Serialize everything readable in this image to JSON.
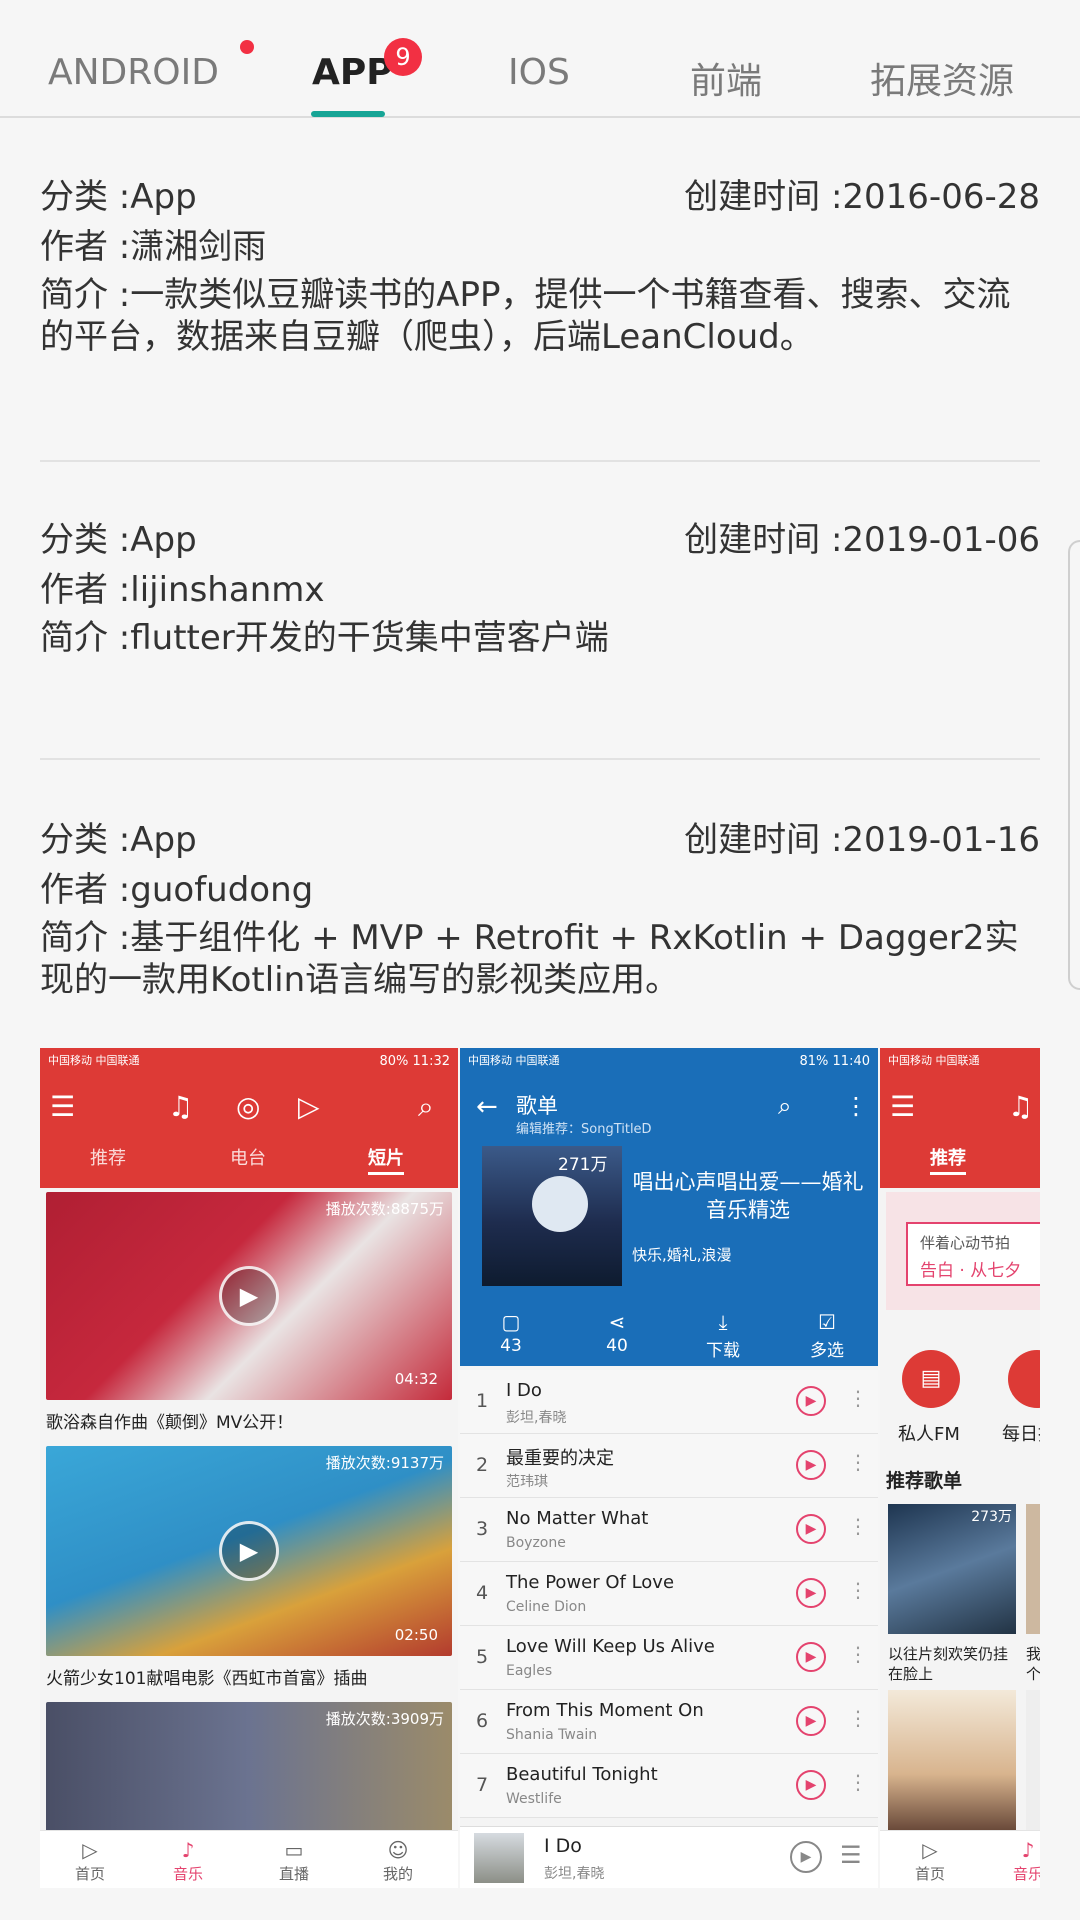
{
  "tabs": [
    {
      "label": "ANDROID"
    },
    {
      "label": "APP",
      "badge": "9"
    },
    {
      "label": "IOS"
    },
    {
      "label": "前端"
    },
    {
      "label": "拓展资源"
    }
  ],
  "entries": [
    {
      "category": "分类 :App",
      "created": "创建时间 :2016-06-28",
      "author": "作者 :潇湘剑雨",
      "desc": "简介 :一款类似豆瓣读书的APP，提供一个书籍查看、搜索、交流的平台，数据来自豆瓣（爬虫），后端LeanCloud。"
    },
    {
      "category": "分类 :App",
      "created": "创建时间 :2019-01-06",
      "author": "作者 :lijinshanmx",
      "desc": "简介 :flutter开发的干货集中营客户端"
    },
    {
      "category": "分类 :App",
      "created": "创建时间 :2019-01-16",
      "author": "作者 :guofudong",
      "desc": "简介 :基于组件化 + MVP + Retrofit + RxKotlin + Dagger2实现的一款用Kotlin语言编写的影视类应用。"
    }
  ],
  "shot1": {
    "status_left": "中国移动 中国联通",
    "status_right": "80% 11:32",
    "tabs": [
      "推荐",
      "电台",
      "短片"
    ],
    "videos": [
      {
        "plays": "播放次数:8875万",
        "duration": "04:32",
        "caption": "歌浴森自作曲《颠倒》MV公开！"
      },
      {
        "plays": "播放次数:9137万",
        "duration": "02:50",
        "caption": "火箭少女101献唱电影《西虹市首富》插曲"
      },
      {
        "plays": "播放次数:3909万",
        "duration": "",
        "caption": ""
      }
    ],
    "nav": [
      "首页",
      "音乐",
      "直播",
      "我的"
    ]
  },
  "shot2": {
    "status_left": "中国移动 中国联通",
    "status_right": "81% 11:40",
    "title": "歌单",
    "subtitle": "编辑推荐：SongTitleD",
    "cover_count": "271万",
    "playlist_title": "唱出心声唱出爱——婚礼音乐精选",
    "tags": "快乐,婚礼,浪漫",
    "actions": [
      {
        "icon": "comment-icon",
        "label": "43"
      },
      {
        "icon": "share-icon",
        "label": "40"
      },
      {
        "icon": "download-icon",
        "label": "下载"
      },
      {
        "icon": "checkbox-icon",
        "label": "多选"
      }
    ],
    "songs": [
      {
        "num": "1",
        "title": "I Do",
        "artist": "彭坦,春晓"
      },
      {
        "num": "2",
        "title": "最重要的决定",
        "artist": "范玮琪"
      },
      {
        "num": "3",
        "title": "No Matter What",
        "artist": "Boyzone"
      },
      {
        "num": "4",
        "title": "The Power Of Love",
        "artist": "Celine Dion"
      },
      {
        "num": "5",
        "title": "Love Will Keep Us Alive",
        "artist": "Eagles"
      },
      {
        "num": "6",
        "title": "From This Moment On",
        "artist": "Shania Twain"
      },
      {
        "num": "7",
        "title": "Beautiful Tonight",
        "artist": "Westlife"
      }
    ],
    "player": {
      "title": "I Do",
      "artist": "彭坦,春晓"
    }
  },
  "shot3": {
    "status_left": "中国移动 中国联通",
    "tab": "推荐",
    "banner_text": "伴着心动节拍",
    "banner_big": "告白 · 从七夕",
    "fm_label": "私人FM",
    "daily_label": "每日推",
    "section": "推荐歌单",
    "card_count": "273万",
    "card_caption": "以往片刻欢笑仍挂在脸上",
    "card_caption2": "我 个,",
    "nav": [
      "首页",
      "音乐"
    ]
  }
}
